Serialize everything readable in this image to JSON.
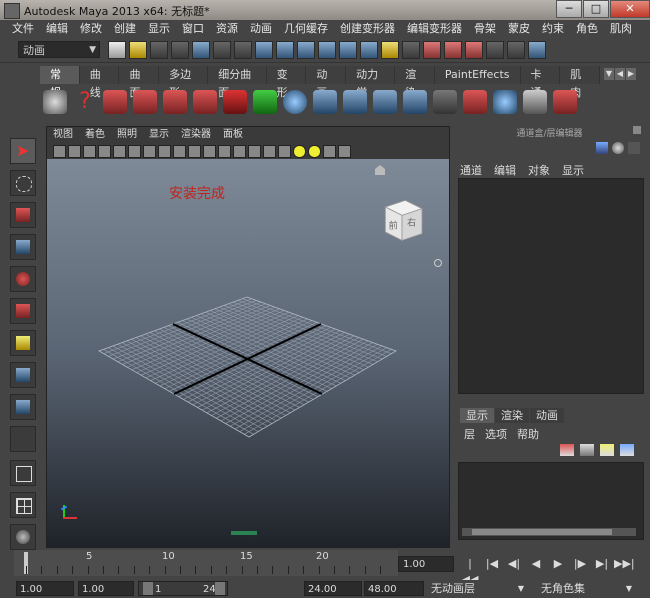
{
  "window": {
    "title": "Autodesk Maya 2013 x64: 无标题*",
    "min": "─",
    "max": "□",
    "close": "✕"
  },
  "menubar": [
    "文件",
    "编辑",
    "修改",
    "创建",
    "显示",
    "窗口",
    "资源",
    "动画",
    "几何缓存",
    "创建变形器",
    "编辑变形器",
    "骨架",
    "蒙皮",
    "约束",
    "角色",
    "肌肉"
  ],
  "status": {
    "mode": "动画"
  },
  "shelf": {
    "tabs": [
      "常规",
      "曲线",
      "曲面",
      "多边形",
      "细分曲面",
      "变形",
      "动画",
      "动力学",
      "渲染",
      "PaintEffects",
      "卡通",
      "肌肉"
    ],
    "active_tab": "常规"
  },
  "viewport": {
    "menu": [
      "视图",
      "着色",
      "照明",
      "显示",
      "渲染器",
      "面板"
    ],
    "annotation": "安装完成",
    "cube_front": "前",
    "cube_right": "右"
  },
  "channelbox": {
    "title": "通道盒/层编辑器",
    "menu": [
      "通道",
      "编辑",
      "对象",
      "显示"
    ]
  },
  "layers": {
    "tabs": [
      "显示",
      "渲染",
      "动画"
    ],
    "menu": [
      "层",
      "选项",
      "帮助"
    ]
  },
  "timeline": {
    "ticks": [
      "5",
      "10",
      "15",
      "20"
    ],
    "current_time": "1.00"
  },
  "rangebar": {
    "start": "1.00",
    "anim_start": "1.00",
    "range_start": "1",
    "range_end": "24",
    "anim_end": "24.00",
    "end": "48.00",
    "anim_layer": "无动画层",
    "char_set": "无角色集"
  },
  "colors": {
    "accent_red": "#c0241b",
    "viewport_top": "#7f8a98",
    "viewport_bottom": "#1f2329"
  }
}
